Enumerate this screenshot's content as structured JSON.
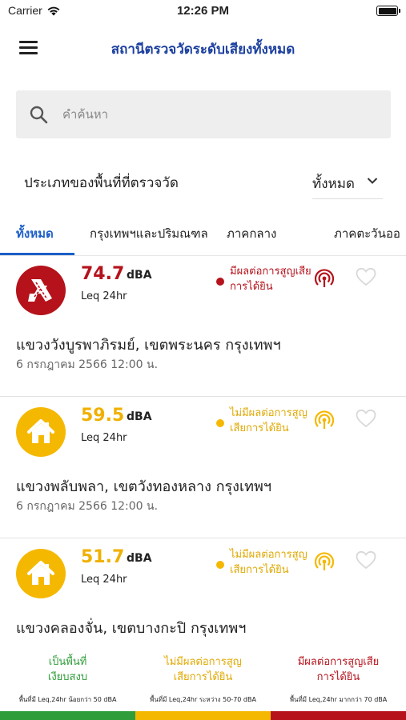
{
  "status_bar": {
    "carrier": "Carrier",
    "time": "12:26 PM"
  },
  "header": {
    "title": "สถานีตรวจวัดระดับเสียงทั้งหมด"
  },
  "search": {
    "placeholder": "คำค้นหา",
    "value": ""
  },
  "filter": {
    "label": "ประเภทของพื้นที่ที่ตรวจวัด",
    "selected": "ทั้งหมด"
  },
  "tabs": [
    {
      "label": "ทั้งหมด",
      "active": true
    },
    {
      "label": "กรุงเทพฯและปริมณฑล",
      "active": false
    },
    {
      "label": "ภาคกลาง",
      "active": false
    },
    {
      "label": "ภาคตะวันออ",
      "active": false
    }
  ],
  "stations": [
    {
      "value": "74.7",
      "unit": "dBA",
      "leq": "Leq 24hr",
      "status": "มีผลต่อการสูญเสียการได้ยิน",
      "location": "แขวงวังบูรพาภิรมย์, เขตพระนคร กรุงเทพฯ",
      "date": "6 กรกฎาคม 2566 12:00 น.",
      "icon": "road-icon",
      "color": "#b5121b"
    },
    {
      "value": "59.5",
      "unit": "dBA",
      "leq": "Leq 24hr",
      "status": "ไม่มีผลต่อการสูญเสียการได้ยิน",
      "location": "แขวงพลับพลา, เขตวังทองหลาง กรุงเทพฯ",
      "date": "6 กรกฎาคม 2566 12:00 น.",
      "icon": "home-icon",
      "color": "#f5b800"
    },
    {
      "value": "51.7",
      "unit": "dBA",
      "leq": "Leq 24hr",
      "status": "ไม่มีผลต่อการสูญเสียการได้ยิน",
      "location": "แขวงคลองจั่น, เขตบางกะปิ กรุงเทพฯ",
      "date": "",
      "icon": "home-icon",
      "color": "#f5b800"
    }
  ],
  "legend": [
    {
      "title": "เป็นพื้นที่เงียบสงบ",
      "desc": "พื้นที่มี Leq,24hr น้อยกว่า 50 dBA",
      "color": "#2f9e3a",
      "text_color": "#2f9e3a"
    },
    {
      "title": "ไม่มีผลต่อการสูญเสียการได้ยิน",
      "desc": "พื้นที่มี Leq,24hr ระหว่าง 50-70 dBA",
      "color": "#f5b800",
      "text_color": "#e0a800"
    },
    {
      "title": "มีผลต่อการสูญเสียการได้ยิน",
      "desc": "พื้นที่มี Leq,24hr มากกว่า 70 dBA",
      "color": "#b5121b",
      "text_color": "#b5121b"
    }
  ]
}
